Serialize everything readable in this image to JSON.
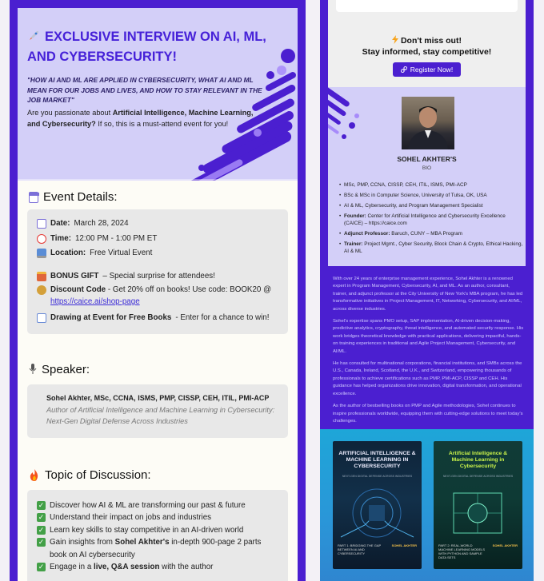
{
  "colors": {
    "brand_purple": "#4b1fd0",
    "hero_lavender": "#d3cff8",
    "card_gray": "#e8e8e8",
    "link_blue": "#3b2bd6"
  },
  "hero": {
    "title": "EXCLUSIVE INTERVIEW ON AI, ML, AND CYBERSECURITY!",
    "quote": "\"HOW AI AND ML ARE APPLIED IN CYBERSECURITY, WHAT AI AND ML MEAN FOR OUR JOBS AND LIVES, AND HOW TO STAY RELEVANT IN THE JOB MARKET\"",
    "intro_a": "Are you passionate about ",
    "intro_b": "Artificial Intelligence, Machine Learning, and Cybersecurity?",
    "intro_c": " If so, this is a must-attend event for you!"
  },
  "event": {
    "heading": "Event Details:",
    "date_label": "Date:",
    "date_value": "March 28, 2024",
    "time_label": "Time:",
    "time_value": "12:00 PM - 1:00 PM ET",
    "location_label": "Location:",
    "location_value": "Free Virtual Event",
    "bonus_label": "BONUS GIFT",
    "bonus_value": "– Special surprise for attendees!",
    "discount_label": "Discount Code",
    "discount_value": "- Get 20% off on books! Use code: BOOK20 @",
    "discount_link": "https://caice.ai/shop-page",
    "drawing_label": "Drawing at Event for Free Books",
    "drawing_value": "- Enter for a chance to win!"
  },
  "speaker": {
    "heading": "Speaker:",
    "name": "Sohel Akhter, MSc, CCNA, ISMS, PMP, CISSP, CEH, ITIL, PMI-ACP",
    "role": "Author of Artificial Intelligence and Machine Learning in Cybersecurity: Next-Gen Digital Defense Across Industries"
  },
  "topics": {
    "heading": "Topic of Discussion:",
    "item1": "Discover how AI & ML are transforming our past & future",
    "item2": "Understand their impact on jobs and industries",
    "item3": "Learn key skills to stay competitive in an AI-driven world",
    "item4_a": "Gain insights from ",
    "item4_b": "Sohel Akhter's",
    "item4_c": " in-depth 900-page 2 parts book on AI cybersecurity",
    "item5_a": "Engage in a ",
    "item5_b": "live, Q&A session",
    "item5_c": " with the author"
  },
  "cta": {
    "title": "Don't miss out!",
    "subtitle": "Stay informed, stay competitive!",
    "button": "Register Now!"
  },
  "bio": {
    "name": "SOHEL AKHTER'S",
    "sub": "BIO",
    "items": [
      {
        "label": "",
        "text": "MSc, PMP, CCNA, CISSP, CEH, ITIL, ISMS, PMI-ACP"
      },
      {
        "label": "",
        "text": "BSc & MSc in Computer Science, University of Tulsa, OK, USA"
      },
      {
        "label": "",
        "text": "AI & ML, Cybersecurity, and Program Management Specialist"
      },
      {
        "label": "Founder:",
        "text": " Center for Artificial Intelligence and Cybersecurity Excellence (CAICE) – https://caice.com"
      },
      {
        "label": "Adjunct Professor:",
        "text": " Baruch, CUNY – MBA Program"
      },
      {
        "label": "Trainer:",
        "text": " Project Mgmt., Cyber Security, Block Chain & Crypto, Ethical Hacking, AI & ML"
      }
    ],
    "paragraphs": [
      "With over 24 years of enterprise management experience, Sohel Akhter is a renowned expert in Program Management, Cybersecurity, AI, and ML. As an author, consultant, trainer, and adjunct professor at the City University of New York's MBA program, he has led transformative initiatives in Project Management, IT, Networking, Cybersecurity, and AI/ML, across diverse industries.",
      "Sohel's expertise spans PMO setup, SAP implementation, AI-driven decision-making, predictive analytics, cryptography, threat intelligence, and automated security response. His work bridges theoretical knowledge with practical applications, delivering impactful, hands-on training experiences in traditional and Agile Project Management, Cybersecurity, and AI/ML.",
      "He has consulted for multinational corporations, financial institutions, and SMBs across the U.S., Canada, Ireland, Scotland, the U.K., and Switzerland, empowering thousands of professionals to achieve certifications such as PMP, PMI-ACP, CISSP and CEH. His guidance has helped organizations drive innovation, digital transformation, and operational excellence.",
      "As the author of bestselling books on PMP and Agile methodologies, Sohel continues to inspire professionals worldwide, equipping them with cutting-edge solutions to meet today's challenges."
    ]
  },
  "books": [
    {
      "title": "ARTIFICIAL INTELLIGENCE & MACHINE LEARNING IN CYBERSECURITY",
      "tag": "NEXT-GEN DIGITAL DEFENSE ACROSS INDUSTRIES",
      "part": "PART 1: BRIDGING THE GAP BETWEEN AI AND CYBERSECURITY",
      "author": "SOHEL AKHTER"
    },
    {
      "title": "Artificial Intelligence & Machine Learning in Cybersecurity",
      "tag": "NEXT-GEN DIGITAL DEFENSE ACROSS INDUSTRIES",
      "part": "PART 2: REAL-WORLD MACHINE LEARNING MODELS WITH PYTHON AND SAMPLE DATA SETS",
      "author": "SOHEL AKHTER"
    }
  ]
}
